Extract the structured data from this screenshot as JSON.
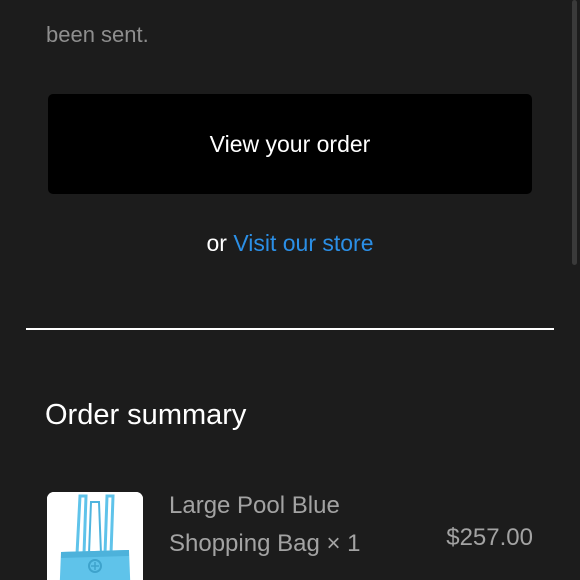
{
  "intro": {
    "line_partial": "...",
    "line_2": "been sent."
  },
  "actions": {
    "view_order_label": "View your order",
    "or_label": "or",
    "visit_store_label": "Visit our store"
  },
  "summary": {
    "title": "Order summary",
    "items": [
      {
        "name_line_1": "Large Pool Blue",
        "name_line_2": "Shopping Bag × 1",
        "price": "$257.00",
        "thumbnail_icon": "blue-shopping-bag-image"
      }
    ]
  },
  "colors": {
    "background": "#1c1c1c",
    "button": "#000000",
    "link": "#2b8fe6",
    "muted_text": "#8e8e8e",
    "bag_blue": "#5fc3ea"
  }
}
